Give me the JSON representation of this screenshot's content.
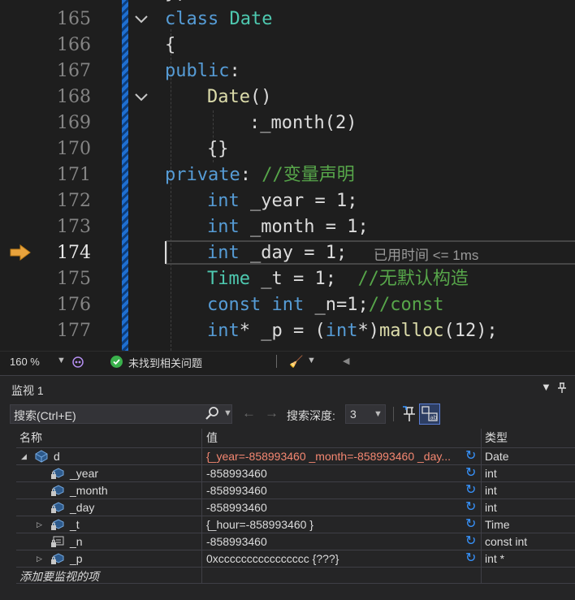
{
  "colors": {
    "keyword": "#569cd6",
    "type": "#4ec9b0",
    "function": "#dcdcaa",
    "comment": "#57a64a",
    "changed_value": "#f48771",
    "exec_arrow": "#e8a33d"
  },
  "editor": {
    "line_numbers": [
      "165",
      "166",
      "167",
      "168",
      "169",
      "170",
      "171",
      "172",
      "173",
      "174",
      "175",
      "176",
      "177"
    ],
    "current_line": "174",
    "elapsed_hint": "已用时间 <= 1ms",
    "code": {
      "l165_kw": "class",
      "l165_name": "Date",
      "l166": "{",
      "l167_kw": "public",
      "l167_punct": ":",
      "l168_fn": "Date",
      "l168_punct": "()",
      "l169_a": ":_month",
      "l169_b": "(2)",
      "l170": "{}",
      "l171_kw": "private",
      "l171_punct": ":",
      "l171_comment": "//变量声明",
      "l172_kw": "int",
      "l172_rest": " _year = 1;",
      "l173_kw": "int",
      "l173_rest": " _month = 1;",
      "l174_kw": "int",
      "l174_rest": " _day = 1;",
      "l175_ty": "Time",
      "l175_rest": " _t = 1;  ",
      "l175_comment": "//无默认构造",
      "l176_kw1": "const",
      "l176_kw2": "int",
      "l176_rest": " _n=1;",
      "l176_comment": "//const",
      "l177_kw": "int",
      "l177_rest1": "* _p = (",
      "l177_kw2": "int",
      "l177_rest2": "*)",
      "l177_fn": "malloc",
      "l177_rest3": "(12);"
    }
  },
  "status": {
    "zoom": "160 %",
    "issues": "未找到相关问题"
  },
  "watch": {
    "title": "监视 1",
    "search_placeholder": "搜索(Ctrl+E)",
    "depth_label": "搜索深度:",
    "depth_value": "3",
    "columns": {
      "name": "名称",
      "value": "值",
      "type": "类型"
    },
    "rows": [
      {
        "name": "d",
        "value": "{_year=-858993460 _month=-858993460 _day...",
        "type": "Date",
        "expanded": true
      },
      {
        "name": "_year",
        "value": "-858993460",
        "type": "int"
      },
      {
        "name": "_month",
        "value": "-858993460",
        "type": "int"
      },
      {
        "name": "_day",
        "value": "-858993460",
        "type": "int"
      },
      {
        "name": "_t",
        "value": "{_hour=-858993460 }",
        "type": "Time",
        "collapsed": true
      },
      {
        "name": "_n",
        "value": "-858993460",
        "type": "const int"
      },
      {
        "name": "_p",
        "value": "0xcccccccccccccccc {???}",
        "type": "int *",
        "collapsed": true
      }
    ],
    "add_item": "添加要监视的项"
  }
}
